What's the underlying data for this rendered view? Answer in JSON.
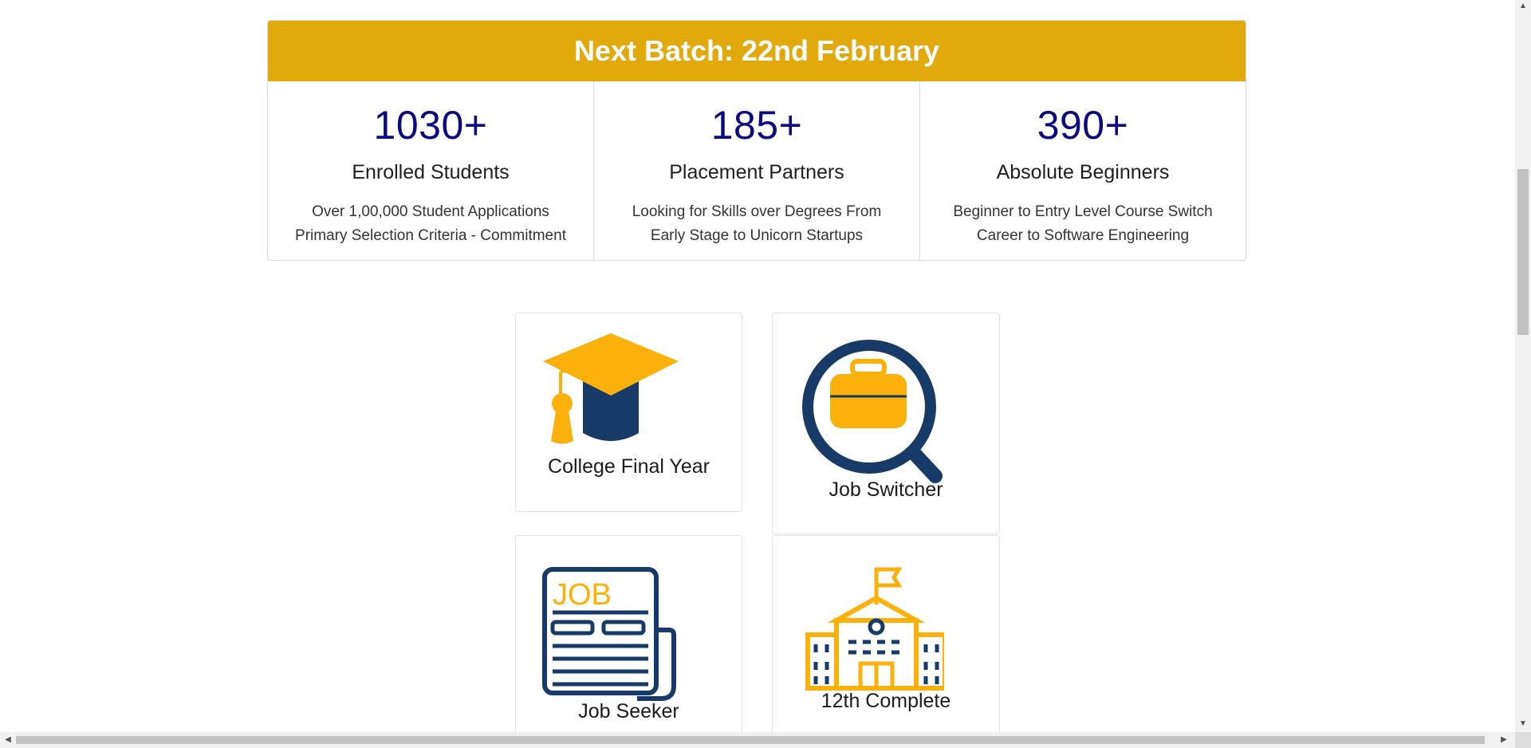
{
  "banner": {
    "text": "Next Batch: 22nd February"
  },
  "stats": [
    {
      "number": "1030+",
      "title": "Enrolled Students",
      "line1": "Over 1,00,000 Student Applications",
      "line2": "Primary Selection Criteria - Commitment"
    },
    {
      "number": "185+",
      "title": "Placement Partners",
      "line1": "Looking for Skills over Degrees From",
      "line2": "Early Stage to Unicorn Startups"
    },
    {
      "number": "390+",
      "title": "Absolute Beginners",
      "line1": "Beginner to Entry Level Course Switch",
      "line2": "Career to Software Engineering"
    }
  ],
  "cards": {
    "college": {
      "label": "College Final Year",
      "icon": "graduation-cap-icon"
    },
    "switcher": {
      "label": "Job Switcher",
      "icon": "briefcase-search-icon"
    },
    "seeker": {
      "label": "Job Seeker",
      "icon": "job-newspaper-icon",
      "icon_text": "JOB"
    },
    "twelfth": {
      "label": "12th Complete",
      "icon": "school-building-icon"
    }
  },
  "colors": {
    "accent_gold": "#e2a90c",
    "icon_yellow": "#fbb10a",
    "icon_navy": "#173a68",
    "number_blue": "#0c0a80"
  }
}
